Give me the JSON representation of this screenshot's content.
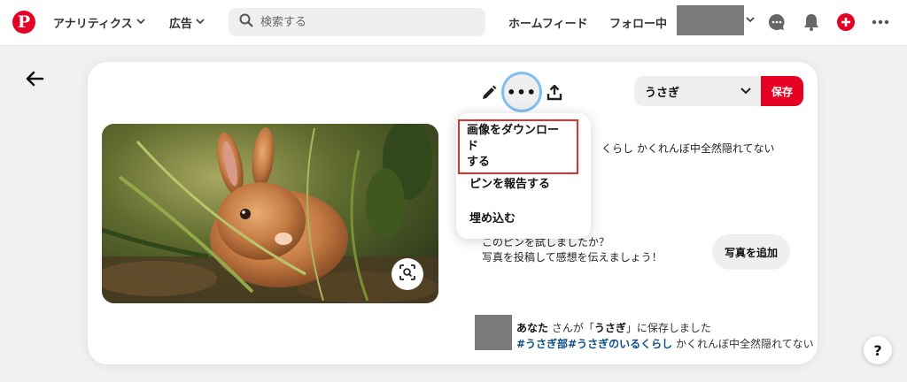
{
  "nav": {
    "logo": "P",
    "analytics_label": "アナリティクス",
    "ads_label": "広告",
    "search_placeholder": "検索する",
    "home_feed_label": "ホームフィード",
    "following_label": "フォロー中",
    "chevron": "∨"
  },
  "pin": {
    "more_label": "•••",
    "board_name": "うさぎ",
    "save_label": "保存",
    "description": "くらし かくれんぼ中全然隠れてない",
    "tried_question": "このピンを試しましたか？",
    "tried_prompt": "写真を投稿して感想を伝えましょう！",
    "add_photo_label": "写真を追加",
    "saved_user": "あなた",
    "saved_text_mid": "さんが「",
    "saved_board": "うさぎ",
    "saved_text_end": "」に保存しました",
    "tag1": "#うさぎ部",
    "tag2": "#うさぎのいるくらし",
    "saved_desc": "かくれんぼ中全然隠れてない"
  },
  "menu": {
    "download_line1": "画像をダウンロード",
    "download_line2": "する",
    "report": "ピンを報告する",
    "embed": "埋め込む"
  },
  "help_label": "?",
  "colors": {
    "brand_red": "#e60023",
    "highlight_red": "#e03030",
    "focus_ring": "#7fc0f0"
  }
}
